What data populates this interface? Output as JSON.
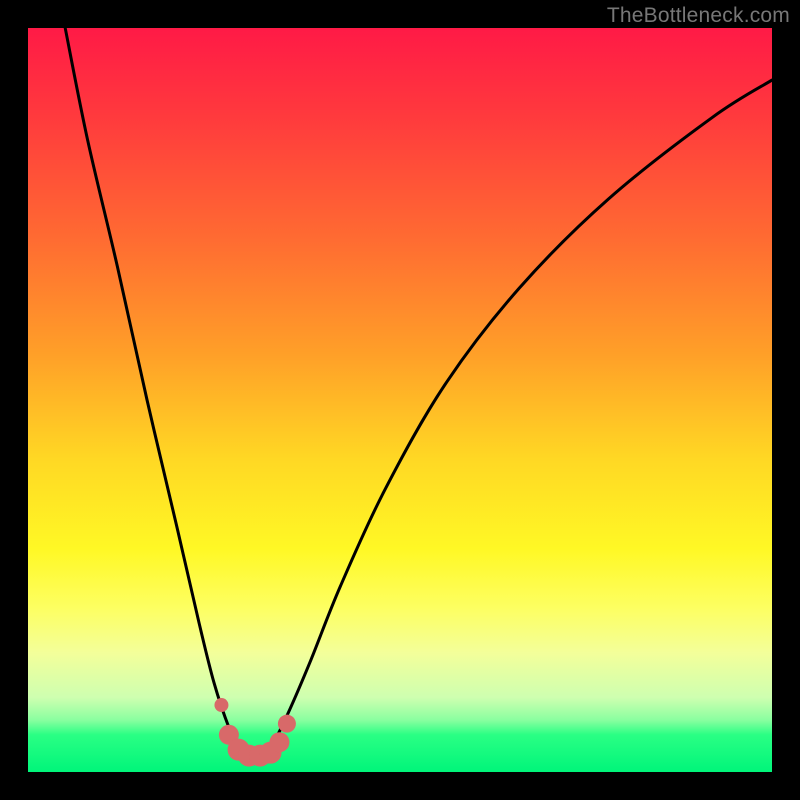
{
  "watermark": "TheBottleneck.com",
  "chart_data": {
    "type": "line",
    "title": "",
    "xlabel": "",
    "ylabel": "",
    "xlim": [
      0,
      100
    ],
    "ylim": [
      0,
      100
    ],
    "series": [
      {
        "name": "bottleneck-curve",
        "x": [
          5,
          8,
          12,
          16,
          20,
          23,
          25,
          27,
          28.5,
          30,
          31.5,
          33,
          35,
          38,
          42,
          48,
          56,
          66,
          78,
          92,
          100
        ],
        "y": [
          100,
          85,
          68,
          50,
          33,
          20,
          12,
          6,
          3,
          2,
          2.5,
          4,
          8,
          15,
          25,
          38,
          52,
          65,
          77,
          88,
          93
        ]
      }
    ],
    "markers": {
      "name": "sweet-spot-cluster",
      "color": "#d86969",
      "points": [
        {
          "x": 26.0,
          "y": 9.0,
          "r": 7
        },
        {
          "x": 27.0,
          "y": 5.0,
          "r": 10
        },
        {
          "x": 28.3,
          "y": 3.0,
          "r": 11
        },
        {
          "x": 29.7,
          "y": 2.2,
          "r": 11
        },
        {
          "x": 31.2,
          "y": 2.2,
          "r": 11
        },
        {
          "x": 32.6,
          "y": 2.6,
          "r": 11
        },
        {
          "x": 33.8,
          "y": 4.0,
          "r": 10
        },
        {
          "x": 34.8,
          "y": 6.5,
          "r": 9
        }
      ]
    },
    "background_gradient": {
      "top": "#ff1a46",
      "mid": "#ffe225",
      "bottom": "#00f57a"
    }
  }
}
